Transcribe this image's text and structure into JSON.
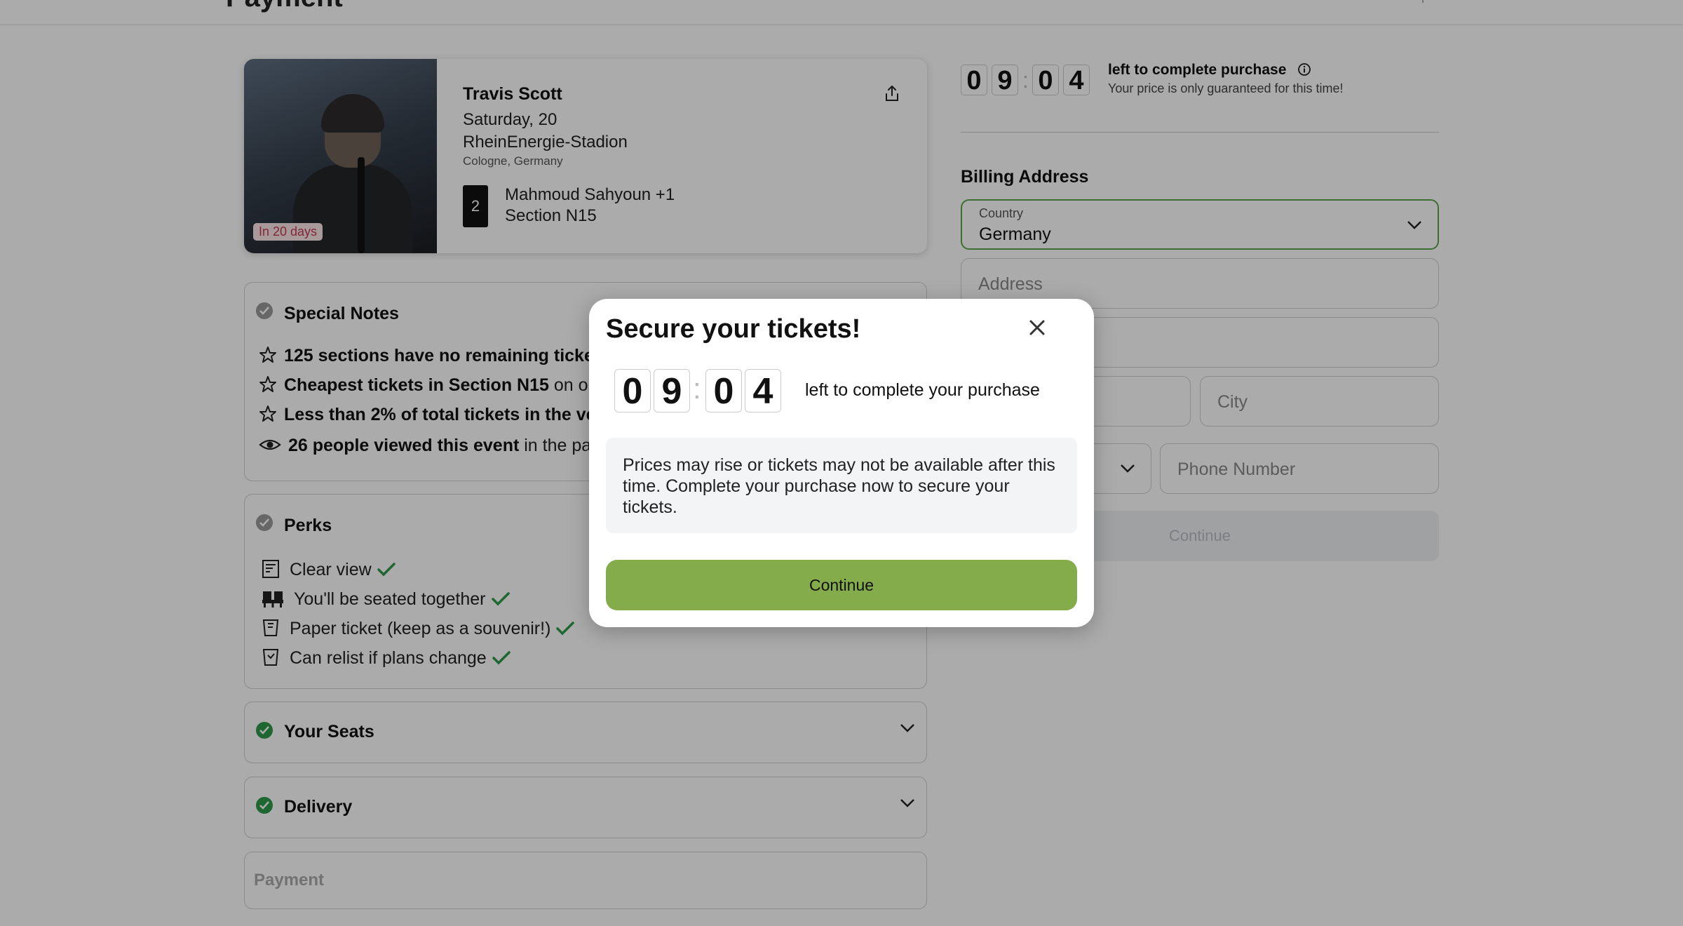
{
  "header": {
    "title": "Payment"
  },
  "event": {
    "artist": "Travis Scott",
    "date": "Saturday, 20",
    "venue": "RheinEnergie-Stadion",
    "location": "Cologne, Germany",
    "badge": "In 20 days",
    "ticket_quantity": "2",
    "holder": "Mahmoud Sahyoun +1",
    "section": "Section N15"
  },
  "special_notes": {
    "title": "Special Notes",
    "items": [
      {
        "bold": "125 sections have no remaining ticke",
        "rest": "",
        "icon": "star-icon"
      },
      {
        "bold": "Cheapest tickets in Section N15",
        "rest": " on ou",
        "icon": "star-icon"
      },
      {
        "bold": "Less than 2% of total tickets in the ve",
        "rest": "",
        "icon": "star-icon"
      },
      {
        "bold": "26 people viewed this event",
        "rest": " in the pa",
        "icon": "eye-icon"
      }
    ]
  },
  "perks": {
    "title": "Perks",
    "items": [
      {
        "label": "Clear view",
        "icon": "view-icon"
      },
      {
        "label": "You'll be seated together",
        "icon": "seats-icon"
      },
      {
        "label": "Paper ticket (keep as a souvenir!)",
        "icon": "ticket-icon"
      },
      {
        "label": "Can relist if plans change",
        "icon": "relist-icon"
      }
    ]
  },
  "your_seats": {
    "title": "Your Seats"
  },
  "delivery": {
    "title": "Delivery"
  },
  "payment": {
    "title": "Payment"
  },
  "timer": {
    "digits": [
      "0",
      "9",
      "0",
      "4"
    ],
    "label": "left to complete purchase",
    "subtext": "Your price is only guaranteed for this time!"
  },
  "billing": {
    "title": "Billing Address",
    "country_label": "Country",
    "country_value": "Germany",
    "address_placeholder": "Address",
    "city_placeholder": "City",
    "phone_placeholder": "Phone Number",
    "continue_label": "Continue"
  },
  "modal": {
    "title": "Secure your tickets!",
    "timer_label": "left to complete your purchase",
    "notice": "Prices may rise or tickets may not be available after this time. Complete your purchase now to secure your tickets.",
    "continue_label": "Continue"
  },
  "colors": {
    "accent_green": "#84ac4a",
    "check_green": "#2e9a4a",
    "badge_red": "#c0394e"
  }
}
